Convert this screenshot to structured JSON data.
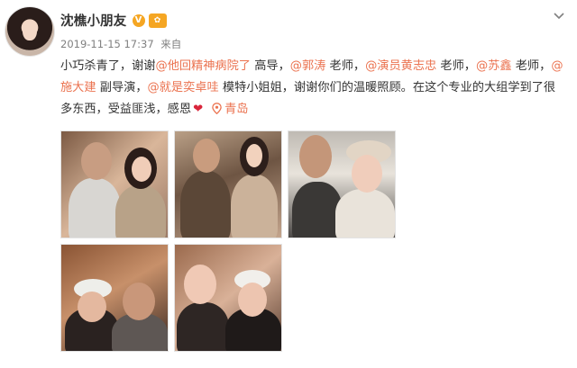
{
  "user": {
    "name": "沈樵小朋友",
    "verified_symbol": "V",
    "level_symbol": "✿"
  },
  "meta": {
    "timestamp": "2019-11-15 17:37",
    "source": "来自"
  },
  "post": {
    "segments": [
      {
        "type": "text",
        "value": "小巧杀青了，谢谢"
      },
      {
        "type": "mention",
        "value": "@他回精神病院了"
      },
      {
        "type": "text",
        "value": " 高导，"
      },
      {
        "type": "mention",
        "value": "@郭涛"
      },
      {
        "type": "text",
        "value": " 老师，"
      },
      {
        "type": "mention",
        "value": "@演员黄志忠"
      },
      {
        "type": "text",
        "value": " 老师，"
      },
      {
        "type": "mention",
        "value": "@苏鑫"
      },
      {
        "type": "text",
        "value": " 老师，"
      },
      {
        "type": "mention",
        "value": "@施大建"
      },
      {
        "type": "text",
        "value": " 副导演，"
      },
      {
        "type": "mention",
        "value": "@就是奕卓哇"
      },
      {
        "type": "text",
        "value": " 模特小姐姐，谢谢你们的温暖照顾。在这个专业的大组学到了很多东西，受益匪浅，感恩"
      }
    ],
    "heart": "❤",
    "location": "青岛"
  },
  "photos": [
    {
      "name": "photo-1"
    },
    {
      "name": "photo-2"
    },
    {
      "name": "photo-3"
    },
    {
      "name": "photo-4"
    },
    {
      "name": "photo-5"
    }
  ],
  "colors": {
    "mention": "#eb7350",
    "meta": "#808080",
    "text": "#333333",
    "badge": "#f5a623"
  },
  "icons": {
    "menu": "chevron-down-icon",
    "location": "location-pin-icon",
    "heart": "heart-emoji-icon"
  }
}
